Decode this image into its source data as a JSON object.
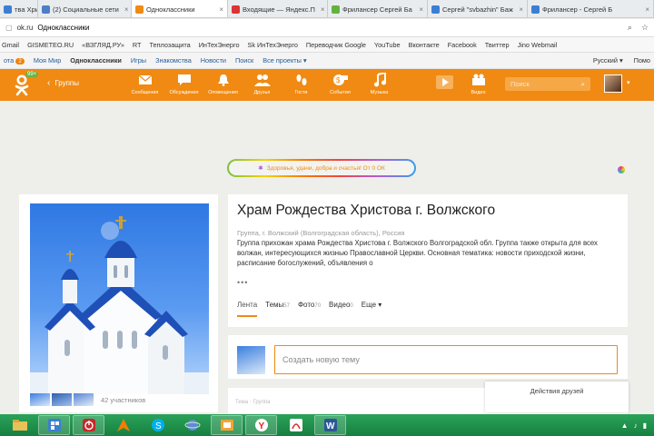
{
  "browser": {
    "tabs": [
      {
        "label": "тва Хрис",
        "color": "#3b7fd4",
        "active": false
      },
      {
        "label": "(2) Социальные сети",
        "color": "#4b7fc6",
        "active": false
      },
      {
        "label": "Одноклассники",
        "color": "#f08a13",
        "active": true
      },
      {
        "label": "Входящие — Яндекс.П",
        "color": "#d33",
        "active": false
      },
      {
        "label": "Фрилансер Сергей Ба",
        "color": "#61b33e",
        "active": false
      },
      {
        "label": "Сергей \"svbazhin\" Баж",
        "color": "#3b7fd4",
        "active": false
      },
      {
        "label": "Фрилансер - Сергей Б",
        "color": "#3b7fd4",
        "active": false
      }
    ],
    "address": {
      "domain": "ok.ru",
      "page_title": "Одноклассники"
    },
    "bookmarks": [
      "Gmail",
      "GISMETEO.RU",
      "«ВЗГЛЯД.РУ»",
      "RT",
      "Теплозащита",
      "ИнТехЭнерго",
      "Sk ИнТехЭнерго",
      "Переводчик Google",
      "YouTube",
      "Вконтакте",
      "Facebook",
      "Твиттер",
      "Jino Webmail"
    ]
  },
  "toplinks": {
    "items": [
      "ота",
      "Моя Мир",
      "Одноклассники",
      "Игры",
      "Знакомства",
      "Новости",
      "Поиск",
      "Все проекты ▾"
    ],
    "badge": "2",
    "right": [
      "Русский ▾",
      "Помо"
    ]
  },
  "header": {
    "logo_count": "99+",
    "back_label": "Группы",
    "nav": [
      {
        "label": "Сообщения",
        "icon": "envelope-icon"
      },
      {
        "label": "Обсуждения",
        "icon": "chat-icon"
      },
      {
        "label": "Оповещения",
        "icon": "bell-icon"
      },
      {
        "label": "Друзья",
        "icon": "friends-icon"
      },
      {
        "label": "Гости",
        "icon": "footprints-icon"
      },
      {
        "label": "События",
        "icon": "events-icon"
      },
      {
        "label": "Музыка",
        "icon": "music-icon"
      },
      {
        "label": "Видео",
        "icon": "video-icon"
      }
    ],
    "search_placeholder": "Поиск"
  },
  "promo": {
    "text": "Здоровья, удачи, добра и счастья! От 0 ОК"
  },
  "group": {
    "title": "Храм Рождества Христова г. Волжского",
    "location": "Группа, г. Волжский (Волгоградская область), Россия",
    "description": "Группа прихожан храма Рождества Христова г. Волжского Волгоградской обл. Группа также открыта для всех волжан, интересующихся жизнью Православной Церкви. Основная тематика: новости приходской жизни, расписание богослужений, объявления о",
    "more": "•••",
    "tabs": [
      {
        "label": "Лента",
        "count": ""
      },
      {
        "label": "Темы",
        "count": "57"
      },
      {
        "label": "Фото",
        "count": "70"
      },
      {
        "label": "Видео",
        "count": "0"
      },
      {
        "label": "Еще ▾",
        "count": ""
      }
    ],
    "members": "42 участников"
  },
  "new_topic": {
    "placeholder": "Создать новую тему"
  },
  "feed_stub": "Тема · Группа",
  "friends_actions": "Действия друзей",
  "taskbar": {
    "apps": [
      "explorer",
      "taskview",
      "power",
      "avast",
      "skype",
      "network",
      "office",
      "yandex",
      "acrobat",
      "word"
    ],
    "tray": [
      "▲",
      "♪",
      "▮"
    ]
  }
}
